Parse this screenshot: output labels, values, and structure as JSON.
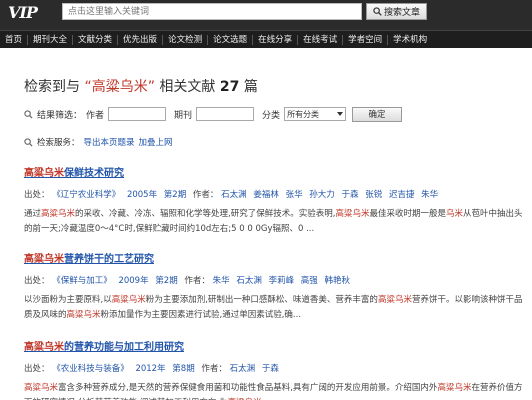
{
  "header": {
    "logo_text": "VIP",
    "search_placeholder": "点击这里输入关键词",
    "search_button": "搜索文章"
  },
  "nav": [
    "首页",
    "期刊大全",
    "文献分类",
    "优先出版",
    "论文检测",
    "论文选题",
    "在线分享",
    "在线考试",
    "学者空间",
    "学术机构"
  ],
  "result_heading": {
    "prefix": "检索到与",
    "keyword": "“高粱乌米”",
    "middle": "相关文献",
    "count": "27",
    "suffix": "篇"
  },
  "filters": {
    "label": "结果筛选：",
    "author_label": "作者",
    "journal_label": "期刊",
    "category_label": "分类",
    "category_value": "所有分类",
    "confirm": "确定"
  },
  "services": {
    "label": "检索服务：",
    "export": "导出本页题录",
    "favorite": "加叠上网"
  },
  "results": [
    {
      "title_hl": "高粱乌米",
      "title_rest": "保鲜技术研究",
      "source_label": "出处：",
      "journal": "《辽宁农业科学》",
      "year": "2005年",
      "issue": "第2期",
      "author_label": "作者：",
      "authors": [
        "石太渊",
        "姜福林",
        "张华",
        "孙大力",
        "于森",
        "张锐",
        "迟吉捷",
        "朱华"
      ],
      "abstract": [
        {
          "t": "通过",
          "h": false
        },
        {
          "t": "高粱乌米",
          "h": true
        },
        {
          "t": "的采收、冷藏、冷冻、辐照和化学等处理,研究了保鲜技术。实验表明,",
          "h": false
        },
        {
          "t": "高粱乌米",
          "h": true
        },
        {
          "t": "最佳采收时期一般是",
          "h": false
        },
        {
          "t": "乌米",
          "h": true
        },
        {
          "t": "从苞叶中抽出头的前一天;冷藏温度0～4°C时,保鲜贮藏时间约10d左右;5 0 0 0Gy辐照、0 ...",
          "h": false
        }
      ]
    },
    {
      "title_hl": "高粱乌米",
      "title_rest": "营养饼干的工艺研究",
      "source_label": "出处：",
      "journal": "《保鲜与加工》",
      "year": "2009年",
      "issue": "第2期",
      "author_label": "作者：",
      "authors": [
        "朱华",
        "石太渊",
        "李莉峰",
        "高强",
        "韩艳秋"
      ],
      "abstract": [
        {
          "t": "以沙面粉为主要原料,以",
          "h": false
        },
        {
          "t": "高粱乌米",
          "h": true
        },
        {
          "t": "粉为主要添加剂,研制出一种口感酥松、味道香美、营养丰富的",
          "h": false
        },
        {
          "t": "高粱乌米",
          "h": true
        },
        {
          "t": "营养饼干。以影响该种饼干品质及风味的",
          "h": false
        },
        {
          "t": "高粱乌米",
          "h": true
        },
        {
          "t": "粉添加量作为主要因素进行试验,通过单因素试验,确...",
          "h": false
        }
      ]
    },
    {
      "title_hl": "高粱乌米",
      "title_rest": "的营养功能与加工利用研究",
      "source_label": "出处：",
      "journal": "《农业科技与装备》",
      "year": "2012年",
      "issue": "第8期",
      "author_label": "作者：",
      "authors": [
        "石太渊",
        "于森"
      ],
      "abstract": [
        {
          "t": "高粱乌米",
          "h": true
        },
        {
          "t": "富含多种营养成分,是天然的营养保健食用菌和功能性食品基料,具有广阔的开发应用前景。介绍国内外",
          "h": false
        },
        {
          "t": "高粱乌米",
          "h": true
        },
        {
          "t": "在营养价值方面的研究情况,分析其营养功能,阐述其加工利用方向,为",
          "h": false
        },
        {
          "t": "高粱乌米",
          "h": true
        }
      ]
    }
  ],
  "colors": {
    "topbar": "#2b2b2b",
    "navbar": "#1e1e1e",
    "link": "#2255aa",
    "highlight": "#c0392b"
  }
}
